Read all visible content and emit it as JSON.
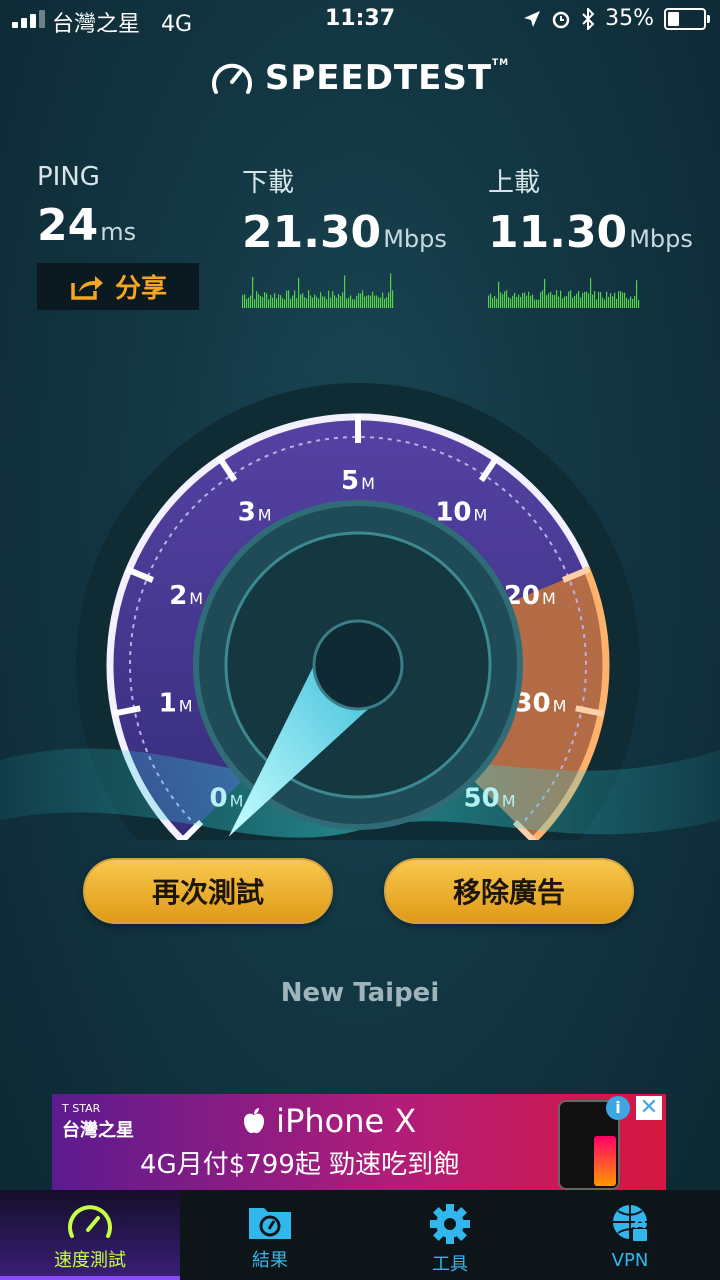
{
  "status_bar": {
    "carrier": "台灣之星",
    "network": "4G",
    "time": "11:37",
    "battery": "35%",
    "battery_level": 0.35
  },
  "app": {
    "logo_text": "SPEEDTEST"
  },
  "results": {
    "ping": {
      "label": "PING",
      "value": "24",
      "unit": "ms"
    },
    "download": {
      "label": "下載",
      "value": "21.30",
      "unit": "Mbps"
    },
    "upload": {
      "label": "上載",
      "value": "11.30",
      "unit": "Mbps"
    },
    "share_label": "分享"
  },
  "gauge": {
    "ticks": [
      {
        "num": "0",
        "unit": "M"
      },
      {
        "num": "1",
        "unit": "M"
      },
      {
        "num": "2",
        "unit": "M"
      },
      {
        "num": "3",
        "unit": "M"
      },
      {
        "num": "5",
        "unit": "M"
      },
      {
        "num": "10",
        "unit": "M"
      },
      {
        "num": "20",
        "unit": "M"
      },
      {
        "num": "30",
        "unit": "M"
      },
      {
        "num": "50",
        "unit": "M"
      }
    ],
    "needle_value_mbps": 0
  },
  "actions": {
    "retest": "再次測試",
    "remove_ads": "移除廣告"
  },
  "location": "New Taipei",
  "ad": {
    "brand_small": "T STAR",
    "brand": "台灣之星",
    "headline": "iPhone X",
    "subline": "4G月付$799起  勁速吃到飽",
    "info_symbol": "i",
    "close_symbol": "✕"
  },
  "tabs": [
    {
      "label": "速度測試",
      "icon": "speedometer-icon",
      "active": true
    },
    {
      "label": "結果",
      "icon": "results-folder-icon",
      "active": false
    },
    {
      "label": "工具",
      "icon": "gear-icon",
      "active": false
    },
    {
      "label": "VPN",
      "icon": "vpn-globe-lock-icon",
      "active": false
    }
  ],
  "colors": {
    "accent_orange": "#f6a623",
    "tab_blue": "#32b7ec",
    "tab_active_green": "#c7ff45",
    "gauge_purple": "#5b3fa8"
  }
}
